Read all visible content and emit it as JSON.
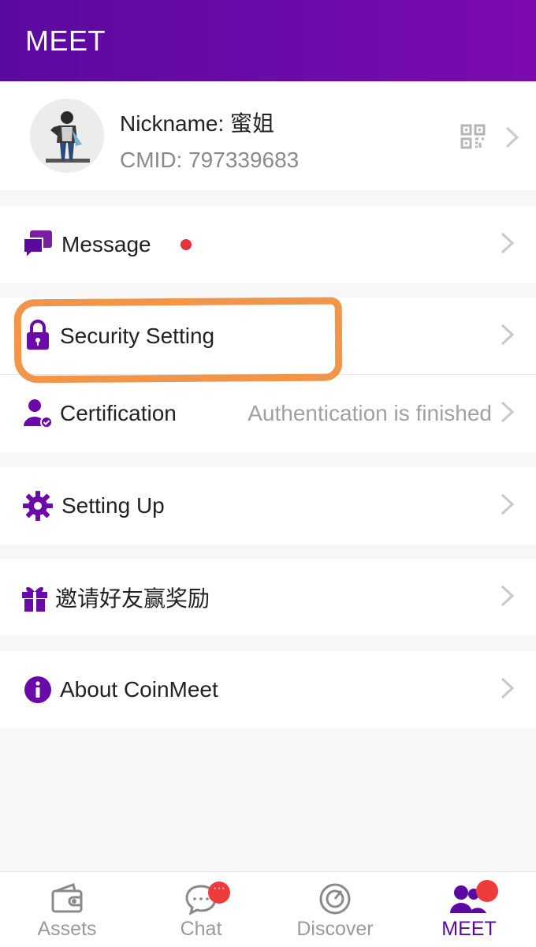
{
  "header": {
    "title": "MEET"
  },
  "profile": {
    "nickname": "Nickname: 蜜姐",
    "cmid": "CMID: 797339683"
  },
  "menu": {
    "message": {
      "label": "Message",
      "has_unread_dot": true
    },
    "security": {
      "label": "Security Setting"
    },
    "certification": {
      "label": "Certification",
      "value": "Authentication is finished"
    },
    "setting_up": {
      "label": "Setting Up"
    },
    "invite": {
      "label": "邀请好友赢奖励"
    },
    "about": {
      "label": "About CoinMeet"
    }
  },
  "tabs": [
    {
      "label": "Assets",
      "icon": "wallet-icon",
      "active": false
    },
    {
      "label": "Chat",
      "icon": "chat-bubble-icon",
      "active": false,
      "badge": "···"
    },
    {
      "label": "Discover",
      "icon": "compass-icon",
      "active": false
    },
    {
      "label": "MEET",
      "icon": "people-icon",
      "active": true,
      "badge": ""
    }
  ],
  "colors": {
    "brand_purple": "#5a0aa0",
    "alert_red": "#e8323b",
    "annotation_orange": "#f0954a"
  }
}
